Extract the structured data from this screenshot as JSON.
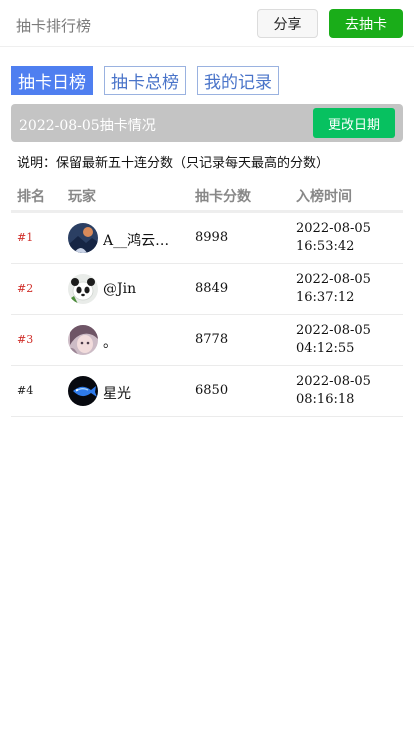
{
  "header": {
    "title": "抽卡排行榜",
    "share_label": "分享",
    "draw_label": "去抽卡"
  },
  "tabs": [
    {
      "label": "抽卡日榜",
      "active": true
    },
    {
      "label": "抽卡总榜",
      "active": false
    },
    {
      "label": "我的记录",
      "active": false
    }
  ],
  "date_bar": {
    "text": "2022-08-05抽卡情况",
    "change_label": "更改日期"
  },
  "note": "说明：保留最新五十连分数（只记录每天最高的分数）",
  "columns": {
    "rank": "排名",
    "player": "玩家",
    "score": "抽卡分数",
    "time": "入榜时间"
  },
  "rows": [
    {
      "rank": "#1",
      "rank_color": "#d0302b",
      "avatar": "avatar-landscape",
      "name": "A__鸿云…",
      "score": "8998",
      "date": "2022-08-05",
      "time": "16:53:42"
    },
    {
      "rank": "#2",
      "rank_color": "#d0302b",
      "avatar": "avatar-panda",
      "name": "@Jin",
      "score": "8849",
      "date": "2022-08-05",
      "time": "16:37:12"
    },
    {
      "rank": "#3",
      "rank_color": "#d0302b",
      "avatar": "avatar-anime",
      "name": "。",
      "score": "8778",
      "date": "2022-08-05",
      "time": "04:12:55"
    },
    {
      "rank": "#4",
      "rank_color": "#222222",
      "avatar": "avatar-fish",
      "name": "星光",
      "score": "6850",
      "date": "2022-08-05",
      "time": "08:16:18"
    }
  ],
  "colors": {
    "accent_green": "#1aad19",
    "tab_blue": "#4f7ff0",
    "rank_red": "#d0302b"
  }
}
